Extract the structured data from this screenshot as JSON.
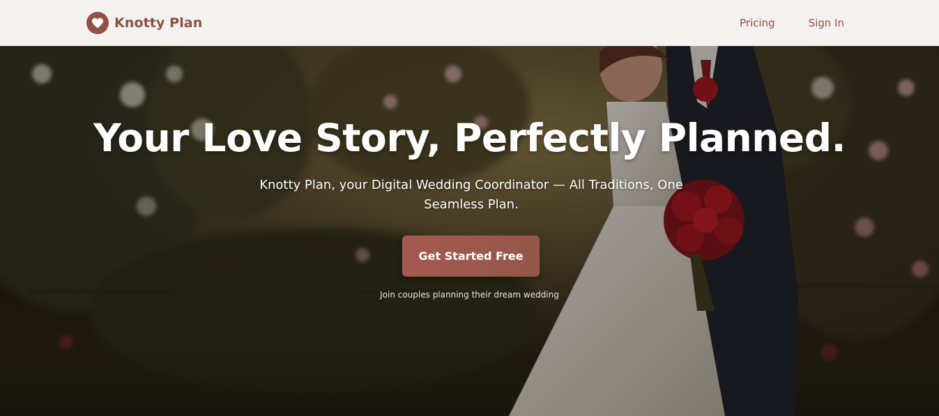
{
  "header": {
    "brand_name": "Knotty Plan",
    "logo_icon": "heart-icon",
    "nav": {
      "pricing_label": "Pricing",
      "signin_label": "Sign In"
    }
  },
  "hero": {
    "title": "Your Love Story, Perfectly Planned.",
    "subtitle": "Knotty Plan, your Digital Wedding Coordinator — All Traditions, One Seamless Plan.",
    "cta_label": "Get Started Free",
    "cta_note": "Join couples planning their dream wedding",
    "background_image": "wedding-couple-garden-photo"
  },
  "colors": {
    "brand": "#8a5145",
    "header_bg": "#f4f2ef",
    "cta": "#a5584f"
  }
}
